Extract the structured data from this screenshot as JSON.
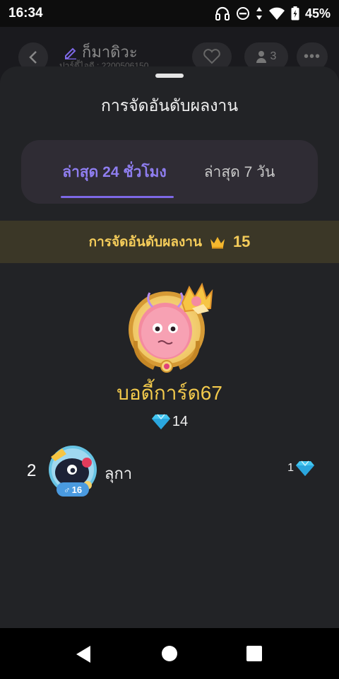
{
  "status_bar": {
    "time": "16:34",
    "battery": "45%"
  },
  "background_page": {
    "title": "ก็มาดิวะ",
    "subtitle": "ปาร์ตี้ไอดี : 2200506150",
    "member_count": "3"
  },
  "sheet": {
    "title": "การจัดอันดับผลงาน",
    "tabs": [
      {
        "label": "ล่าสุด 24 ชั่วโมง",
        "active": true
      },
      {
        "label": "ล่าสุด 7 วัน",
        "active": false
      }
    ],
    "rank_banner": {
      "label": "การจัดอันดับผลงาน",
      "value": "15"
    },
    "top_user": {
      "name": "บอดี้การ์ด67",
      "score": "14"
    },
    "ranking_list": [
      {
        "rank": "2",
        "name": "ลุกา",
        "score": "1",
        "age": "16",
        "gender": "♂"
      }
    ]
  },
  "colors": {
    "accent": "#7d68e6",
    "gold": "#f2c94c",
    "sheet_bg": "#222326"
  },
  "icons": {
    "crown": "crown-icon",
    "diamond": "diamond-icon"
  }
}
